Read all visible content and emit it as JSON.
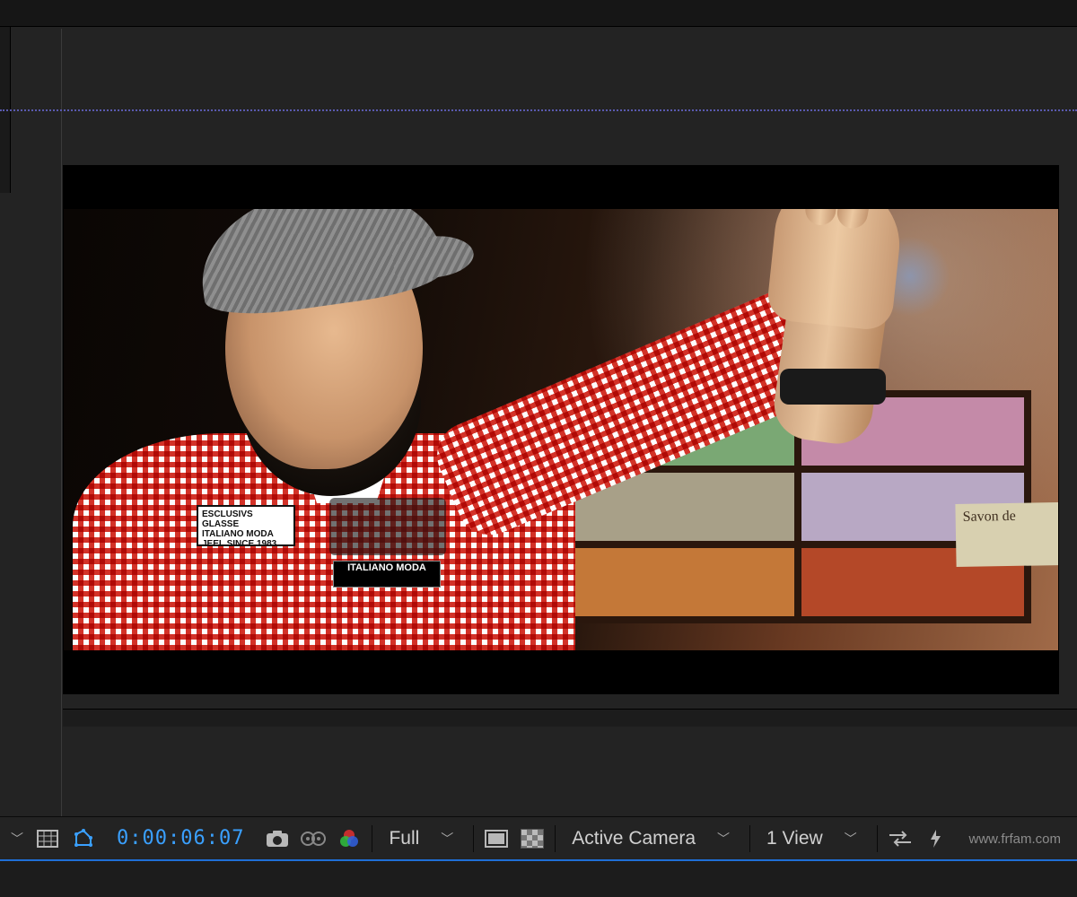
{
  "viewer": {
    "timecode": "0:00:06:07",
    "resolution_label": "Full",
    "camera_label": "Active Camera",
    "view_count_label": "1 View",
    "savon_sign": "Savon de"
  },
  "patches": {
    "line1": "ESCLUSIVS GLASSE",
    "line2": "ITALIANO MODA",
    "line3": "JEEL SINCE 1983",
    "small": "ITALIANO MODA"
  },
  "watermark": "www.frfam.com",
  "icons": {
    "mag": "magnify-dropdown-icon",
    "safe": "safe-zones-icon",
    "mask": "mask-bounds-icon",
    "snapshot": "snapshot-icon",
    "preview": "preview-icon",
    "channels": "channels-icon",
    "transparency_off": "transparency-grid-off-icon",
    "transparency_grid": "transparency-grid-icon",
    "swap": "swap-views-icon",
    "fast": "fast-preview-icon"
  }
}
